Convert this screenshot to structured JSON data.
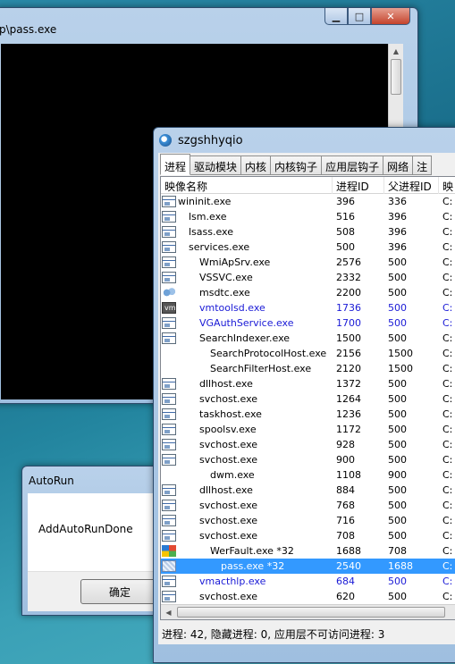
{
  "console": {
    "title": "p\\pass.exe"
  },
  "autorun": {
    "title": "AutoRun",
    "message": "AddAutoRunDone",
    "ok_label": "确定"
  },
  "process_window": {
    "title": "szgshhyqio",
    "tabs": [
      "进程",
      "驱动模块",
      "内核",
      "内核钩子",
      "应用层钩子",
      "网络",
      "注"
    ],
    "columns": [
      "映像名称",
      "进程ID",
      "父进程ID",
      "映"
    ],
    "rows": [
      {
        "name": "wininit.exe",
        "pid": "396",
        "ppid": "336",
        "x": "C:",
        "indent": 0,
        "icon": "process-icon",
        "style": ""
      },
      {
        "name": "lsm.exe",
        "pid": "516",
        "ppid": "396",
        "x": "C:",
        "indent": 1,
        "icon": "process-icon",
        "style": ""
      },
      {
        "name": "lsass.exe",
        "pid": "508",
        "ppid": "396",
        "x": "C:",
        "indent": 1,
        "icon": "process-icon",
        "style": ""
      },
      {
        "name": "services.exe",
        "pid": "500",
        "ppid": "396",
        "x": "C:",
        "indent": 1,
        "icon": "process-icon",
        "style": ""
      },
      {
        "name": "WmiApSrv.exe",
        "pid": "2576",
        "ppid": "500",
        "x": "C:",
        "indent": 2,
        "icon": "process-icon",
        "style": ""
      },
      {
        "name": "VSSVC.exe",
        "pid": "2332",
        "ppid": "500",
        "x": "C:",
        "indent": 2,
        "icon": "process-icon",
        "style": ""
      },
      {
        "name": "msdtc.exe",
        "pid": "2200",
        "ppid": "500",
        "x": "C:",
        "indent": 2,
        "icon": "network-icon",
        "style": ""
      },
      {
        "name": "vmtoolsd.exe",
        "pid": "1736",
        "ppid": "500",
        "x": "C:",
        "indent": 2,
        "icon": "vm-icon",
        "style": "blue"
      },
      {
        "name": "VGAuthService.exe",
        "pid": "1700",
        "ppid": "500",
        "x": "C:",
        "indent": 2,
        "icon": "process-icon",
        "style": "blue"
      },
      {
        "name": "SearchIndexer.exe",
        "pid": "1500",
        "ppid": "500",
        "x": "C:",
        "indent": 2,
        "icon": "process-icon",
        "style": ""
      },
      {
        "name": "SearchProtocolHost.exe",
        "pid": "2156",
        "ppid": "1500",
        "x": "C:",
        "indent": 3,
        "icon": "none",
        "style": ""
      },
      {
        "name": "SearchFilterHost.exe",
        "pid": "2120",
        "ppid": "1500",
        "x": "C:",
        "indent": 3,
        "icon": "none",
        "style": ""
      },
      {
        "name": "dllhost.exe",
        "pid": "1372",
        "ppid": "500",
        "x": "C:",
        "indent": 2,
        "icon": "process-icon",
        "style": ""
      },
      {
        "name": "svchost.exe",
        "pid": "1264",
        "ppid": "500",
        "x": "C:",
        "indent": 2,
        "icon": "process-icon",
        "style": ""
      },
      {
        "name": "taskhost.exe",
        "pid": "1236",
        "ppid": "500",
        "x": "C:",
        "indent": 2,
        "icon": "process-icon",
        "style": ""
      },
      {
        "name": "spoolsv.exe",
        "pid": "1172",
        "ppid": "500",
        "x": "C:",
        "indent": 2,
        "icon": "process-icon",
        "style": ""
      },
      {
        "name": "svchost.exe",
        "pid": "928",
        "ppid": "500",
        "x": "C:",
        "indent": 2,
        "icon": "process-icon",
        "style": ""
      },
      {
        "name": "svchost.exe",
        "pid": "900",
        "ppid": "500",
        "x": "C:",
        "indent": 2,
        "icon": "process-icon",
        "style": ""
      },
      {
        "name": "dwm.exe",
        "pid": "1108",
        "ppid": "900",
        "x": "C:",
        "indent": 3,
        "icon": "none",
        "style": ""
      },
      {
        "name": "dllhost.exe",
        "pid": "884",
        "ppid": "500",
        "x": "C:",
        "indent": 2,
        "icon": "process-icon",
        "style": ""
      },
      {
        "name": "svchost.exe",
        "pid": "768",
        "ppid": "500",
        "x": "C:",
        "indent": 2,
        "icon": "process-icon",
        "style": ""
      },
      {
        "name": "svchost.exe",
        "pid": "716",
        "ppid": "500",
        "x": "C:",
        "indent": 2,
        "icon": "process-icon",
        "style": ""
      },
      {
        "name": "svchost.exe",
        "pid": "708",
        "ppid": "500",
        "x": "C:",
        "indent": 2,
        "icon": "process-icon",
        "style": ""
      },
      {
        "name": "WerFault.exe *32",
        "pid": "1688",
        "ppid": "708",
        "x": "C:",
        "indent": 3,
        "icon": "werfault-icon",
        "style": ""
      },
      {
        "name": "pass.exe *32",
        "pid": "2540",
        "ppid": "1688",
        "x": "C:",
        "indent": 4,
        "icon": "pass-exe-icon",
        "style": "sel"
      },
      {
        "name": "vmacthlp.exe",
        "pid": "684",
        "ppid": "500",
        "x": "C:",
        "indent": 2,
        "icon": "process-icon",
        "style": "blue"
      },
      {
        "name": "svchost.exe",
        "pid": "620",
        "ppid": "500",
        "x": "C:",
        "indent": 2,
        "icon": "process-icon",
        "style": ""
      }
    ],
    "status": "进程: 42, 隐藏进程: 0, 应用层不可访问进程: 3"
  }
}
